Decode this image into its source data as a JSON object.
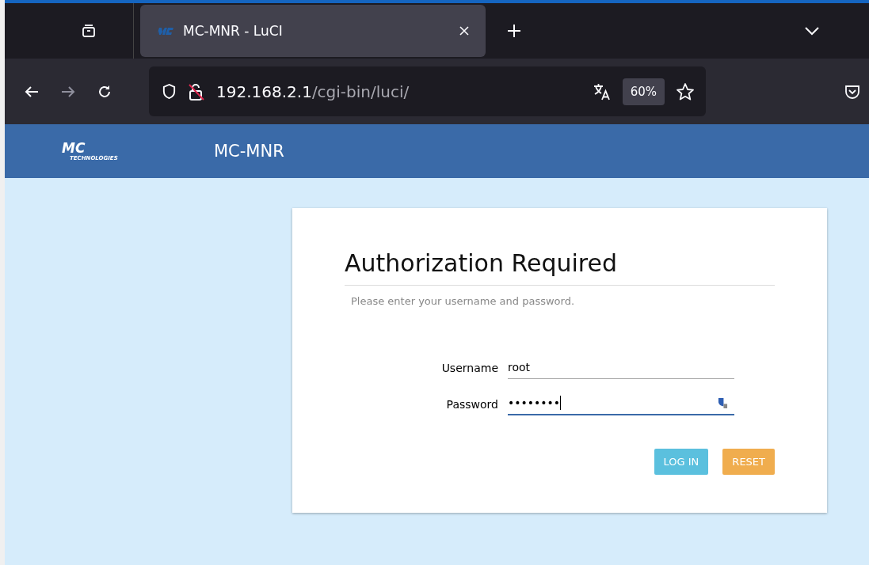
{
  "browser": {
    "tab": {
      "title": "MC-MNR - LuCI",
      "selected": true
    },
    "url": {
      "host": "192.168.2.1",
      "path": "/cgi-bin/luci/"
    },
    "zoom": "60%"
  },
  "header": {
    "logo": {
      "mark": "MC",
      "sub": "TECHNOLOGIES"
    },
    "title": "MC-MNR"
  },
  "login": {
    "title": "Authorization Required",
    "hint": "Please enter your username and password.",
    "fields": [
      {
        "label": "Username",
        "value": "root",
        "focused": false
      },
      {
        "label": "Password",
        "value": "••••••••",
        "focused": true
      }
    ],
    "buttons": [
      {
        "label": "LOG IN",
        "kind": "primary"
      },
      {
        "label": "RESET",
        "kind": "reset"
      }
    ]
  }
}
